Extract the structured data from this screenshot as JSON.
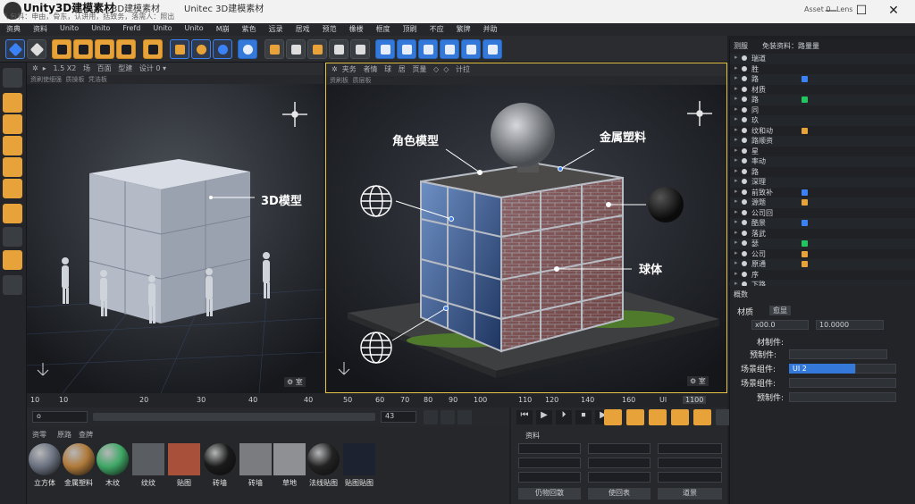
{
  "window": {
    "title": "Unity3D建模素材",
    "tab1": "3D建模素材",
    "tab2": "Unitec 3D建模素材",
    "subtitle": "\\ 包科：申由，骨东，认讲用，括致务，落需人：照出",
    "right_field": "Asset 0",
    "right_label": "Lens",
    "controls": [
      "—",
      "☐",
      "✕"
    ]
  },
  "menu": [
    "资典",
    "资料",
    "Unito",
    "Unito",
    "Frefd",
    "Unito",
    "Unito",
    "M崩",
    "紫色",
    "远录",
    "居戏",
    "预范",
    "橡楼",
    "框度",
    "顶刷",
    "不应",
    "繁牌",
    "并助"
  ],
  "viewport_left": {
    "header_items": [
      "✲",
      "▸",
      "1.5 X2",
      "场",
      "百面",
      "型建",
      "设计 0 ▾"
    ],
    "sub_items": [
      "资刷使细强",
      "质操板",
      "凭浩板"
    ],
    "callout": "3D模型",
    "footer": "⚙ 室"
  },
  "viewport_right": {
    "header_items": [
      "✲",
      "夹务",
      "者情",
      "球",
      "居",
      "页量",
      "◇",
      "◇",
      "计拉"
    ],
    "sub_items": [
      "资刷板",
      "质层板"
    ],
    "callout_character": "角色模型",
    "callout_metal": "金属塑料",
    "callout_sphere": "球体",
    "footer": "⚙ 室"
  },
  "timeline": {
    "ticks": [
      "10",
      "10",
      "20",
      "30",
      "40",
      "40",
      "50",
      "60",
      "70",
      "80",
      "90",
      "100",
      "110",
      "120",
      "140",
      "160",
      "Ul"
    ],
    "end_label": "1100"
  },
  "transport": {
    "dropdown": "o",
    "frame": "43",
    "buttons": [
      "⏮",
      "▶",
      "⏵",
      "⏹",
      "▶"
    ]
  },
  "materials": {
    "tabs": [
      "资零",
      "原路",
      "查牌"
    ],
    "items": [
      {
        "label": "立方体",
        "color": "#6b7280"
      },
      {
        "label": "金属塑料",
        "color": "#b07a3a"
      },
      {
        "label": "木纹",
        "color": "#3fa866"
      },
      {
        "label": "纹纹",
        "color": "#5a5e63"
      },
      {
        "label": "贴图",
        "color": "#a8503a"
      },
      {
        "label": "砖墙",
        "color": "#1a1a1a"
      },
      {
        "label": "砖墙",
        "color": "#7a7c80"
      },
      {
        "label": "草地",
        "color": "#8e9094"
      },
      {
        "label": "法线贴图",
        "color": "#222222"
      },
      {
        "label": "贴图贴图",
        "color": "#1c2230"
      }
    ]
  },
  "lower_right": {
    "title": "资料",
    "buttons": [
      "仍物回散",
      "使回表",
      "道景"
    ]
  },
  "hierarchy": {
    "header": [
      "测服",
      "免装资料：路量量"
    ],
    "rows": [
      "瑞道",
      "胜",
      "路",
      "材质",
      "路",
      "同",
      "玖",
      "纹和动",
      "路顺资",
      "星",
      "率动",
      "路",
      "深理",
      "前致补",
      "源题",
      "公司回",
      "酷景",
      "落武",
      "瑟",
      "公司",
      "原通",
      "序",
      "下路"
    ]
  },
  "inspector": {
    "header": "概数",
    "tab_material": "材质",
    "tab_other": "愈显",
    "field1": "x00.0",
    "field2": "10.0000",
    "label_material_make": "材制件:",
    "label_prefab": "预制件:",
    "label_scene_comp": "场景组件:",
    "scene_comp_value": "UI 2",
    "label_scene_comp2": "场景组件:",
    "label_prefab2": "预制件:"
  }
}
